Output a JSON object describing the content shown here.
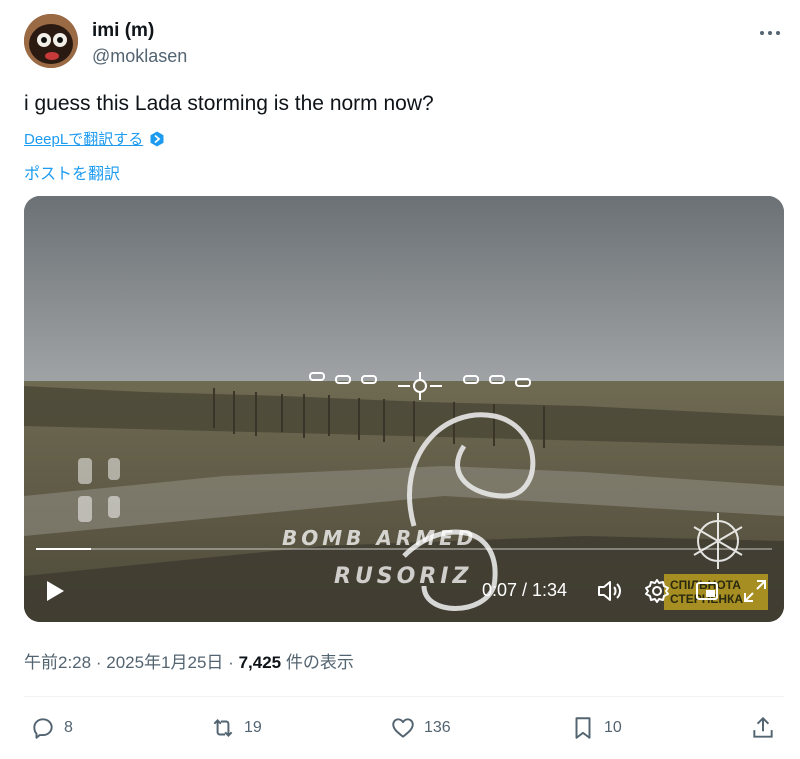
{
  "author": {
    "name": "imi (m)",
    "handle": "@moklasen"
  },
  "tweet": {
    "text": "i guess this Lada storming is the norm now?",
    "deepl_link": "DeepLで翻訳する",
    "translate_link": "ポストを翻訳"
  },
  "video": {
    "overlay_line1": "BOMB ARMED",
    "overlay_line2": "RUSORIZ",
    "current_time": "0:07",
    "duration": "1:34",
    "time_display": "0:07 / 1:34",
    "progress": 0.075,
    "watermark_line1": "СПІЛЬНОТА",
    "watermark_line2": "СТЕРНЕНКА"
  },
  "meta": {
    "time": "午前2:28",
    "date": "2025年1月25日",
    "views_count": "7,425",
    "views_label": "件の表示",
    "separator": "·"
  },
  "actions": {
    "replies": "8",
    "retweets": "19",
    "likes": "136",
    "bookmarks": "10"
  },
  "colors": {
    "accent": "#1d9bf0",
    "secondary_text": "#536471"
  }
}
